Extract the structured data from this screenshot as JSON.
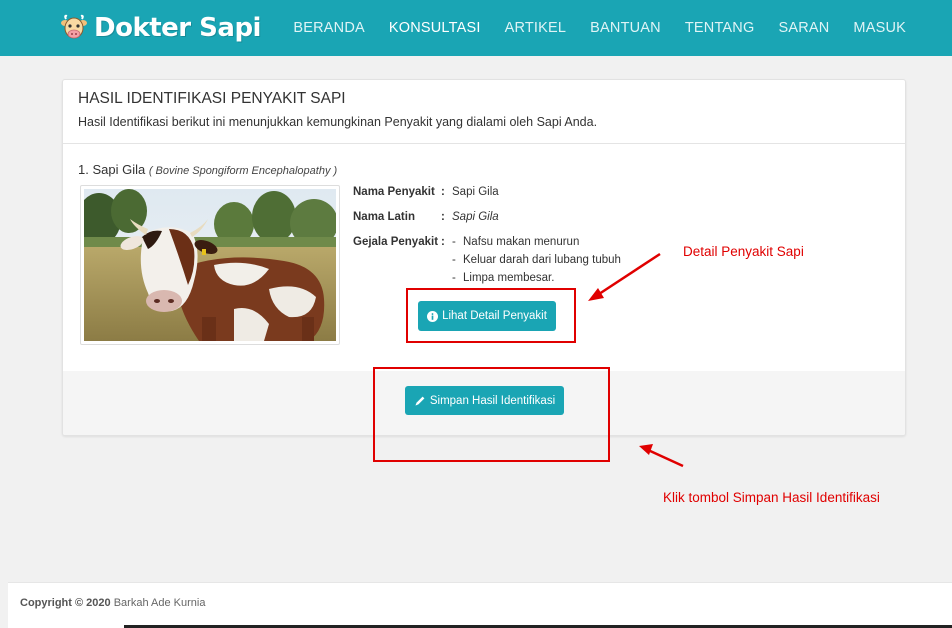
{
  "brand": {
    "name": "Dokter Sapi",
    "logo_icon": "cow-face-icon"
  },
  "nav": {
    "items": [
      {
        "label": "BERANDA",
        "active": false
      },
      {
        "label": "KONSULTASI",
        "active": true
      },
      {
        "label": "ARTIKEL",
        "active": false
      },
      {
        "label": "BANTUAN",
        "active": false
      },
      {
        "label": "TENTANG",
        "active": false
      },
      {
        "label": "SARAN",
        "active": false
      },
      {
        "label": "MASUK",
        "active": false
      }
    ]
  },
  "card": {
    "title": "HASIL IDENTIFIKASI PENYAKIT SAPI",
    "subtitle": "Hasil Identifikasi berikut ini menunjukkan kemungkinan Penyakit yang dialami oleh Sapi Anda."
  },
  "result": {
    "heading": "1. Sapi Gila",
    "heading_latin": "( Bovine Spongiform Encephalopathy )",
    "image_alt": "cow photo",
    "fields": {
      "name_label": "Nama Penyakit",
      "name_value": "Sapi Gila",
      "latin_label": "Nama Latin",
      "latin_value": "Sapi Gila",
      "symptoms_label": "Gejala Penyakit",
      "colon": ":",
      "bullet": "-",
      "symptoms": [
        "Nafsu makan menurun",
        "Keluar darah dari lubang tubuh",
        "Limpa membesar."
      ]
    },
    "detail_button": {
      "label": "Lihat Detail Penyakit",
      "icon": "info-circle-icon"
    }
  },
  "save_button": {
    "label": "Simpan Hasil Identifikasi",
    "icon": "pencil-icon"
  },
  "annotations": {
    "detail_note": "Detail Penyakit Sapi",
    "save_note": "Klik tombol Simpan Hasil Identifikasi",
    "color": "#e00000"
  },
  "footer": {
    "copyright_bold": "Copyright © 2020",
    "author": "Barkah Ade Kurnia"
  },
  "colors": {
    "primary": "#1aa5b4",
    "background": "#f1f1f1"
  }
}
